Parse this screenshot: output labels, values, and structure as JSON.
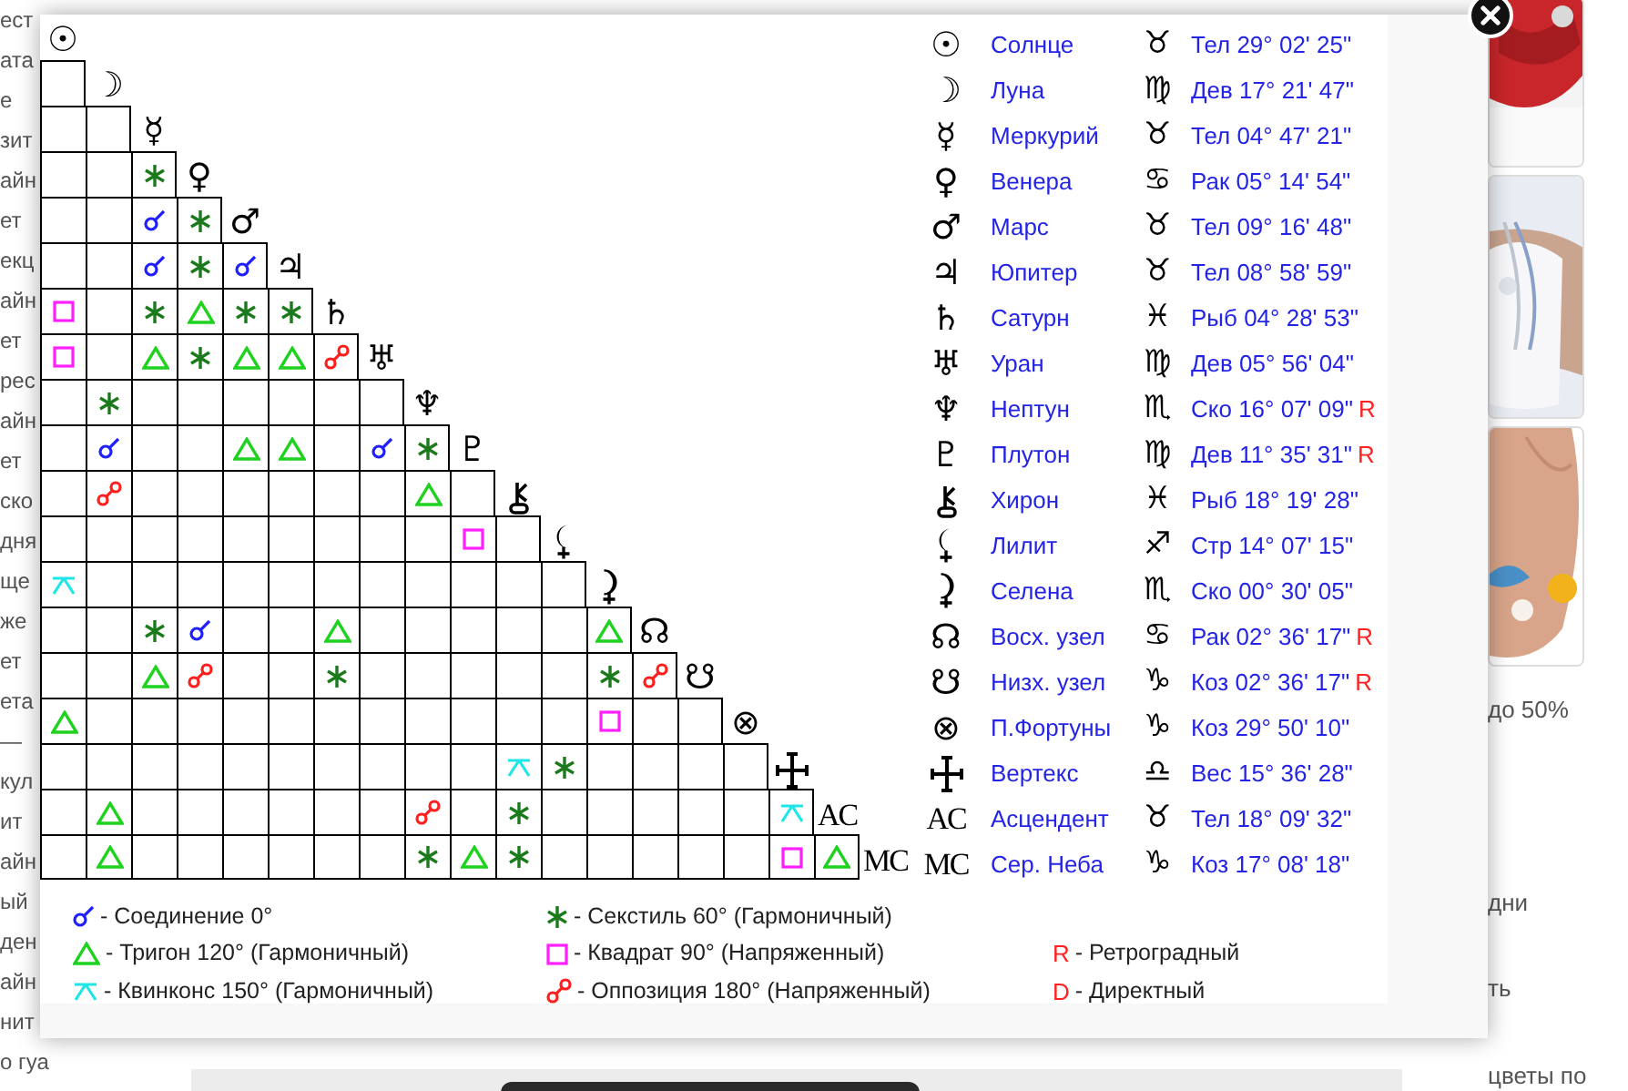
{
  "background": {
    "left_texts": [
      "ест",
      "ата",
      "е",
      "зит",
      "айн",
      "ет",
      "екц",
      "айн",
      "ет",
      "рес",
      "айн",
      "ет",
      "ско",
      "дня",
      "ще",
      "же",
      "ет",
      "ета",
      "—",
      "кул",
      "ит",
      "айн",
      "ый",
      "ден",
      "айн",
      "нит",
      "о гуа"
    ],
    "pictures": [
      {
        "kind": "picture"
      },
      {
        "kind": "picture"
      },
      {
        "kind": "picture"
      }
    ],
    "right_texts": [
      "до 50%",
      "дни",
      "ть",
      "цветы по"
    ]
  },
  "aspect_grid": {
    "rows": [
      {
        "kind": "symbol",
        "glyph": "☉"
      },
      {
        "kind": "symbol",
        "glyph": "☽",
        "cells": [
          {
            "kind": "none"
          }
        ]
      },
      {
        "kind": "symbol",
        "glyph": "☿",
        "cells": [
          {
            "kind": "none"
          },
          {
            "kind": "none"
          }
        ]
      },
      {
        "kind": "symbol",
        "glyph": "♀",
        "cells": [
          {
            "kind": "none"
          },
          {
            "kind": "none"
          },
          {
            "kind": "sextile"
          }
        ]
      },
      {
        "kind": "symbol",
        "glyph": "♂",
        "cells": [
          {
            "kind": "none"
          },
          {
            "kind": "none"
          },
          {
            "kind": "conjunction"
          },
          {
            "kind": "sextile"
          }
        ]
      },
      {
        "kind": "symbol",
        "glyph": "♃",
        "cells": [
          {
            "kind": "none"
          },
          {
            "kind": "none"
          },
          {
            "kind": "conjunction"
          },
          {
            "kind": "sextile"
          },
          {
            "kind": "conjunction"
          }
        ]
      },
      {
        "kind": "symbol",
        "glyph": "♄",
        "cells": [
          {
            "kind": "square"
          },
          {
            "kind": "none"
          },
          {
            "kind": "sextile"
          },
          {
            "kind": "trine"
          },
          {
            "kind": "sextile"
          },
          {
            "kind": "sextile"
          }
        ]
      },
      {
        "kind": "symbol",
        "glyph": "♅",
        "cells": [
          {
            "kind": "square"
          },
          {
            "kind": "none"
          },
          {
            "kind": "trine"
          },
          {
            "kind": "sextile"
          },
          {
            "kind": "trine"
          },
          {
            "kind": "trine"
          },
          {
            "kind": "opposition"
          }
        ]
      },
      {
        "kind": "symbol",
        "glyph": "♆",
        "cells": [
          {
            "kind": "none"
          },
          {
            "kind": "sextile"
          },
          {
            "kind": "none"
          },
          {
            "kind": "none"
          },
          {
            "kind": "none"
          },
          {
            "kind": "none"
          },
          {
            "kind": "none"
          },
          {
            "kind": "none"
          }
        ]
      },
      {
        "kind": "symbol",
        "glyph": "♇",
        "cells": [
          {
            "kind": "none"
          },
          {
            "kind": "conjunction"
          },
          {
            "kind": "none"
          },
          {
            "kind": "none"
          },
          {
            "kind": "trine"
          },
          {
            "kind": "trine"
          },
          {
            "kind": "none"
          },
          {
            "kind": "conjunction"
          },
          {
            "kind": "sextile"
          }
        ]
      },
      {
        "kind": "chiron",
        "cells": [
          {
            "kind": "none"
          },
          {
            "kind": "opposition"
          },
          {
            "kind": "none"
          },
          {
            "kind": "none"
          },
          {
            "kind": "none"
          },
          {
            "kind": "none"
          },
          {
            "kind": "none"
          },
          {
            "kind": "none"
          },
          {
            "kind": "trine"
          },
          {
            "kind": "none"
          }
        ]
      },
      {
        "kind": "lilith",
        "cells": [
          {
            "kind": "none"
          },
          {
            "kind": "none"
          },
          {
            "kind": "none"
          },
          {
            "kind": "none"
          },
          {
            "kind": "none"
          },
          {
            "kind": "none"
          },
          {
            "kind": "none"
          },
          {
            "kind": "none"
          },
          {
            "kind": "none"
          },
          {
            "kind": "square"
          },
          {
            "kind": "none"
          }
        ]
      },
      {
        "kind": "selena",
        "cells": [
          {
            "kind": "quincunx"
          },
          {
            "kind": "none"
          },
          {
            "kind": "none"
          },
          {
            "kind": "none"
          },
          {
            "kind": "none"
          },
          {
            "kind": "none"
          },
          {
            "kind": "none"
          },
          {
            "kind": "none"
          },
          {
            "kind": "none"
          },
          {
            "kind": "none"
          },
          {
            "kind": "none"
          },
          {
            "kind": "none"
          }
        ]
      },
      {
        "kind": "symbol",
        "glyph": "☊",
        "cells": [
          {
            "kind": "none"
          },
          {
            "kind": "none"
          },
          {
            "kind": "sextile"
          },
          {
            "kind": "conjunction"
          },
          {
            "kind": "none"
          },
          {
            "kind": "none"
          },
          {
            "kind": "trine"
          },
          {
            "kind": "none"
          },
          {
            "kind": "none"
          },
          {
            "kind": "none"
          },
          {
            "kind": "none"
          },
          {
            "kind": "none"
          },
          {
            "kind": "trine"
          }
        ]
      },
      {
        "kind": "symbol",
        "glyph": "☋",
        "cells": [
          {
            "kind": "none"
          },
          {
            "kind": "none"
          },
          {
            "kind": "trine"
          },
          {
            "kind": "opposition"
          },
          {
            "kind": "none"
          },
          {
            "kind": "none"
          },
          {
            "kind": "sextile"
          },
          {
            "kind": "none"
          },
          {
            "kind": "none"
          },
          {
            "kind": "none"
          },
          {
            "kind": "none"
          },
          {
            "kind": "none"
          },
          {
            "kind": "sextile"
          },
          {
            "kind": "opposition"
          }
        ]
      },
      {
        "kind": "symbol",
        "glyph": "⊗",
        "cells": [
          {
            "kind": "trine"
          },
          {
            "kind": "none"
          },
          {
            "kind": "none"
          },
          {
            "kind": "none"
          },
          {
            "kind": "none"
          },
          {
            "kind": "none"
          },
          {
            "kind": "none"
          },
          {
            "kind": "none"
          },
          {
            "kind": "none"
          },
          {
            "kind": "none"
          },
          {
            "kind": "none"
          },
          {
            "kind": "none"
          },
          {
            "kind": "square"
          },
          {
            "kind": "none"
          },
          {
            "kind": "none"
          }
        ]
      },
      {
        "kind": "vertex",
        "cells": [
          {
            "kind": "none"
          },
          {
            "kind": "none"
          },
          {
            "kind": "none"
          },
          {
            "kind": "none"
          },
          {
            "kind": "none"
          },
          {
            "kind": "none"
          },
          {
            "kind": "none"
          },
          {
            "kind": "none"
          },
          {
            "kind": "none"
          },
          {
            "kind": "none"
          },
          {
            "kind": "quincunx"
          },
          {
            "kind": "sextile"
          },
          {
            "kind": "none"
          },
          {
            "kind": "none"
          },
          {
            "kind": "none"
          },
          {
            "kind": "none"
          }
        ]
      },
      {
        "kind": "abbreviation",
        "glyph": "AC",
        "cells": [
          {
            "kind": "none"
          },
          {
            "kind": "trine"
          },
          {
            "kind": "none"
          },
          {
            "kind": "none"
          },
          {
            "kind": "none"
          },
          {
            "kind": "none"
          },
          {
            "kind": "none"
          },
          {
            "kind": "none"
          },
          {
            "kind": "opposition"
          },
          {
            "kind": "none"
          },
          {
            "kind": "sextile"
          },
          {
            "kind": "none"
          },
          {
            "kind": "none"
          },
          {
            "kind": "none"
          },
          {
            "kind": "none"
          },
          {
            "kind": "none"
          },
          {
            "kind": "quincunx"
          }
        ]
      },
      {
        "kind": "abbreviation",
        "glyph": "MC",
        "cells": [
          {
            "kind": "none"
          },
          {
            "kind": "trine"
          },
          {
            "kind": "none"
          },
          {
            "kind": "none"
          },
          {
            "kind": "none"
          },
          {
            "kind": "none"
          },
          {
            "kind": "none"
          },
          {
            "kind": "none"
          },
          {
            "kind": "sextile"
          },
          {
            "kind": "trine"
          },
          {
            "kind": "sextile"
          },
          {
            "kind": "none"
          },
          {
            "kind": "none"
          },
          {
            "kind": "none"
          },
          {
            "kind": "none"
          },
          {
            "kind": "none"
          },
          {
            "kind": "square"
          },
          {
            "kind": "trine"
          }
        ]
      }
    ]
  },
  "positions": [
    {
      "kind": "symbol",
      "glyph": "☉",
      "name": "Солнце",
      "sign": "♉",
      "position": "Тел 29° 02' 25\""
    },
    {
      "kind": "symbol",
      "glyph": "☽",
      "name": "Луна",
      "sign": "♍",
      "position": "Дев 17° 21' 47\""
    },
    {
      "kind": "symbol",
      "glyph": "☿",
      "name": "Меркурий",
      "sign": "♉",
      "position": "Тел 04° 47' 21\""
    },
    {
      "kind": "symbol",
      "glyph": "♀",
      "name": "Венера",
      "sign": "♋",
      "position": "Рак 05° 14' 54\""
    },
    {
      "kind": "symbol",
      "glyph": "♂",
      "name": "Марс",
      "sign": "♉",
      "position": "Тел 09° 16' 48\""
    },
    {
      "kind": "symbol",
      "glyph": "♃",
      "name": "Юпитер",
      "sign": "♉",
      "position": "Тел 08° 58' 59\""
    },
    {
      "kind": "symbol",
      "glyph": "♄",
      "name": "Сатурн",
      "sign": "♓",
      "position": "Рыб 04° 28' 53\""
    },
    {
      "kind": "symbol",
      "glyph": "♅",
      "name": "Уран",
      "sign": "♍",
      "position": "Дев 05° 56' 04\""
    },
    {
      "kind": "symbol",
      "glyph": "♆",
      "name": "Нептун",
      "sign": "♏",
      "position": "Ско 16° 07' 09\"",
      "motion": "R"
    },
    {
      "kind": "symbol",
      "glyph": "♇",
      "name": "Плутон",
      "sign": "♍",
      "position": "Дев 11° 35' 31\"",
      "motion": "R"
    },
    {
      "kind": "chiron",
      "name": "Хирон",
      "sign": "♓",
      "position": "Рыб 18° 19' 28\""
    },
    {
      "kind": "lilith",
      "name": "Лилит",
      "sign": "♐",
      "position": "Стр 14° 07' 15\""
    },
    {
      "kind": "selena",
      "name": "Селена",
      "sign": "♏",
      "position": "Ско 00° 30' 05\""
    },
    {
      "kind": "symbol",
      "glyph": "☊",
      "name": "Восх. узел",
      "sign": "♋",
      "position": "Рак 02° 36' 17\"",
      "motion": "R"
    },
    {
      "kind": "symbol",
      "glyph": "☋",
      "name": "Низх. узел",
      "sign": "♑",
      "position": "Коз 02° 36' 17\"",
      "motion": "R"
    },
    {
      "kind": "symbol",
      "glyph": "⊗",
      "name": "П.Фортуны",
      "sign": "♑",
      "position": "Коз 29° 50' 10\""
    },
    {
      "kind": "vertex",
      "name": "Вертекс",
      "sign": "♎",
      "position": "Вес 15° 36' 28\""
    },
    {
      "kind": "abbreviation",
      "glyph": "AC",
      "name": "Асцендент",
      "sign": "♉",
      "position": "Тел 18° 09' 32\""
    },
    {
      "kind": "abbreviation",
      "glyph": "MC",
      "name": "Сер. Неба",
      "sign": "♑",
      "position": "Коз 17° 08' 18\""
    }
  ],
  "legend": {
    "aspects": [
      {
        "kind": "conjunction",
        "label": "- Соединение 0°"
      },
      {
        "kind": "sextile",
        "label": "- Секстиль 60° (Гармоничный)"
      },
      {
        "kind": "trine",
        "label": "- Тригон 120° (Гармоничный)"
      },
      {
        "kind": "square",
        "label": "- Квадрат 90° (Напряженный)"
      },
      {
        "kind": "quincunx",
        "label": "- Квинконс 150° (Гармоничный)"
      },
      {
        "kind": "opposition",
        "label": "- Оппозиция 180° (Напряженный)"
      }
    ],
    "motions": [
      {
        "mark": "R",
        "label": "- Ретроградный"
      },
      {
        "mark": "D",
        "label": "- Директный"
      }
    ]
  }
}
